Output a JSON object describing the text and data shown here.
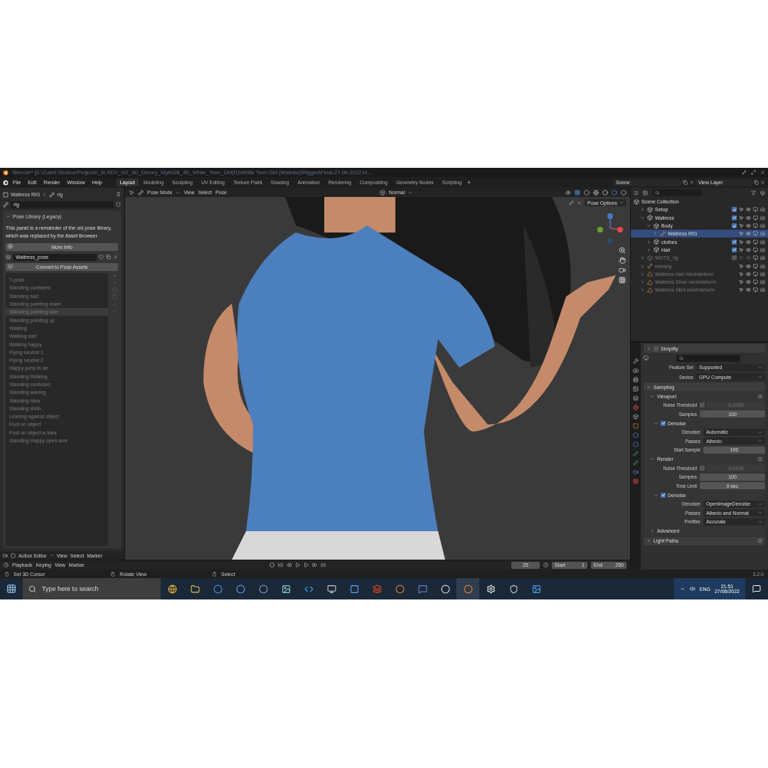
{
  "window": {
    "title": "Blender* [E:\\Zudrit Studios\\Projects\\_8LRDY_\\02_3D_Disney_Style\\06_3D_White_Teen_Girl(D)\\White Teen Girl (Waitriss)\\Rigged\\Final-27-06-2022.bl..."
  },
  "menu": [
    "File",
    "Edit",
    "Render",
    "Window",
    "Help"
  ],
  "workspaces": [
    {
      "label": "Layout",
      "selected": true
    },
    {
      "label": "Modeling",
      "selected": false
    },
    {
      "label": "Sculpting",
      "selected": false
    },
    {
      "label": "UV Editing",
      "selected": false
    },
    {
      "label": "Texture Paint",
      "selected": false
    },
    {
      "label": "Shading",
      "selected": false
    },
    {
      "label": "Animation",
      "selected": false
    },
    {
      "label": "Rendering",
      "selected": false
    },
    {
      "label": "Compositing",
      "selected": false
    },
    {
      "label": "Geometry Nodes",
      "selected": false
    },
    {
      "label": "Scripting",
      "selected": false
    }
  ],
  "scene": "Scene",
  "view_layer": "View Layer",
  "left_panel": {
    "object": "Waitress RIG",
    "data": "rig",
    "data_field": "rig",
    "panel_title": "Pose Library (Legacy)",
    "notice": "This panel is a remainder of the old pose library, which was replaced by the Asset Browser",
    "more_info": "More Info",
    "pose_library": "Waitress_pose",
    "convert": "Convert to Pose Assets",
    "poses": [
      {
        "name": "T-pose",
        "selected": false
      },
      {
        "name": "Standing confident",
        "selected": false
      },
      {
        "name": "Standing sad",
        "selected": false
      },
      {
        "name": "Standing pointing down",
        "selected": false
      },
      {
        "name": "Standing pointing side",
        "selected": true
      },
      {
        "name": "Standing pointing up",
        "selected": false
      },
      {
        "name": "Walking",
        "selected": false
      },
      {
        "name": "Walking sad",
        "selected": false
      },
      {
        "name": "Walking happy",
        "selected": false
      },
      {
        "name": "Flying neutral 1",
        "selected": false
      },
      {
        "name": "Flying neutral 2",
        "selected": false
      },
      {
        "name": "Happy jump in air",
        "selected": false
      },
      {
        "name": "Standing thinking",
        "selected": false
      },
      {
        "name": "Standing confused",
        "selected": false
      },
      {
        "name": "Standing waving",
        "selected": false
      },
      {
        "name": "Standing Idea",
        "selected": false
      },
      {
        "name": "Standing shhh",
        "selected": false
      },
      {
        "name": "Leaning against object",
        "selected": false
      },
      {
        "name": "Foot on object",
        "selected": false
      },
      {
        "name": "Foot on object w idea",
        "selected": false
      },
      {
        "name": "Standing Happy open arm",
        "selected": false
      }
    ]
  },
  "viewport": {
    "mode": "Pose Mode",
    "menus": [
      "View",
      "Select",
      "Pose"
    ],
    "orientation": "Normal",
    "pose_options": "Pose Options"
  },
  "action_editor": {
    "mode": "Action Editor",
    "menus": [
      "View",
      "Select",
      "Marker"
    ]
  },
  "timeline": {
    "menus": [
      "Playback",
      "Keying",
      "View",
      "Marker"
    ],
    "frame": "25",
    "start_label": "Start",
    "start": "1",
    "end_label": "End",
    "end": "250"
  },
  "outliner": {
    "items": [
      {
        "name": "Scene Collection",
        "kind": "scene",
        "children": [
          {
            "name": "Setup",
            "kind": "collection",
            "expanded": false,
            "checked": true,
            "disabled": false
          },
          {
            "name": "Waitress",
            "kind": "collection",
            "expanded": true,
            "checked": true,
            "disabled": false,
            "children": [
              {
                "name": "Body",
                "kind": "collection",
                "expanded": true,
                "checked": true,
                "disabled": false,
                "children": [
                  {
                    "name": "Waitress RIG",
                    "kind": "armature",
                    "expanded": false,
                    "selected": true,
                    "disabled": false
                  }
                ]
              },
              {
                "name": "clothes",
                "kind": "collection",
                "expanded": false,
                "checked": true,
                "disabled": false
              },
              {
                "name": "Hair",
                "kind": "collection",
                "expanded": false,
                "checked": true,
                "disabled": false
              }
            ]
          },
          {
            "name": "WGTS_rig",
            "kind": "collection",
            "expanded": false,
            "checked": false,
            "disabled": true
          },
          {
            "name": "metarig",
            "kind": "armature",
            "expanded": false,
            "selected": false,
            "disabled": true
          },
          {
            "name": "Waitress Hair Meshdeform",
            "kind": "mesh",
            "expanded": false,
            "disabled": true
          },
          {
            "name": "Waitress Shoe meshdeform",
            "kind": "mesh",
            "expanded": false,
            "disabled": true
          },
          {
            "name": "Waitress Skirt meshdeform",
            "kind": "mesh",
            "expanded": false,
            "disabled": true
          }
        ]
      }
    ]
  },
  "properties": {
    "simplify": {
      "label": "Simplify",
      "checked": false
    },
    "rows": [
      {
        "kind": "dropdown",
        "label": "Feature Set",
        "value": "Supported"
      },
      {
        "kind": "dropdown",
        "label": "Device",
        "value": "GPU Compute"
      }
    ],
    "panels": [
      {
        "title": "Sampling",
        "expanded": true,
        "children": [
          {
            "title": "Viewport",
            "expanded": true,
            "presets": true,
            "rows": [
              {
                "kind": "threshold",
                "label": "Noise Threshold",
                "checked": false,
                "value": "0.1000"
              },
              {
                "kind": "number",
                "label": "Samples",
                "value": "100"
              }
            ],
            "children": [
              {
                "title": "Denoise",
                "expanded": true,
                "checked": true,
                "rows": [
                  {
                    "kind": "dropdown",
                    "label": "Denoiser",
                    "value": "Automatic"
                  },
                  {
                    "kind": "dropdown",
                    "label": "Passes",
                    "value": "Albedo"
                  },
                  {
                    "kind": "number",
                    "label": "Start Sample",
                    "value": "100"
                  }
                ]
              }
            ]
          },
          {
            "title": "Render",
            "expanded": true,
            "presets": true,
            "rows": [
              {
                "kind": "threshold",
                "label": "Noise Threshold",
                "checked": false,
                "value": "0.0100"
              },
              {
                "kind": "number",
                "label": "Samples",
                "value": "100"
              },
              {
                "kind": "number",
                "label": "Time Limit",
                "value": "0 sec"
              }
            ],
            "children": [
              {
                "title": "Denoise",
                "expanded": true,
                "checked": true,
                "rows": [
                  {
                    "kind": "dropdown",
                    "label": "Denoiser",
                    "value": "OpenImageDenoise"
                  },
                  {
                    "kind": "dropdown",
                    "label": "Passes",
                    "value": "Albedo and Normal"
                  },
                  {
                    "kind": "dropdown",
                    "label": "Prefilter",
                    "value": "Accurate"
                  }
                ]
              }
            ]
          },
          {
            "title": "Advanced",
            "expanded": false
          }
        ]
      },
      {
        "title": "Light Paths",
        "expanded": false,
        "presets": true
      }
    ]
  },
  "status_bar": {
    "hints": [
      "Set 3D Cursor",
      "Rotate View",
      "Select"
    ],
    "version": "3.2.0"
  },
  "taskbar": {
    "search_placeholder": "Type here to search",
    "language": "ENG",
    "time": "21:51",
    "date": "27/06/2022"
  }
}
